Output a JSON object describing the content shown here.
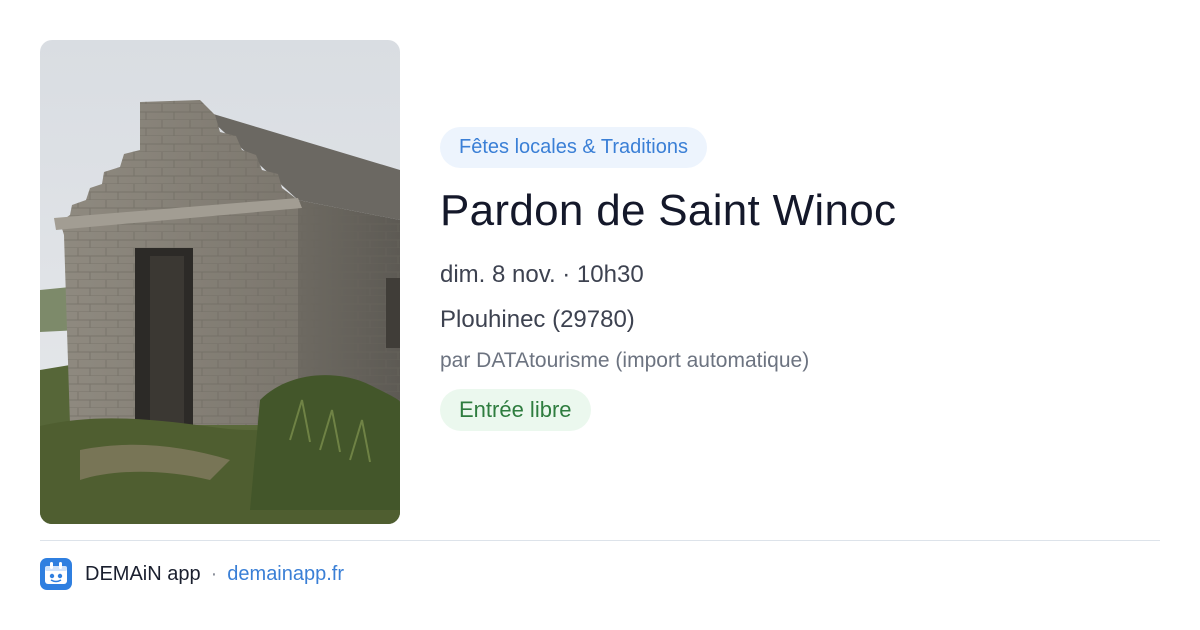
{
  "event": {
    "category": "Fêtes locales & Traditions",
    "title": "Pardon de Saint Winoc",
    "datetime": "dim. 8 nov. · 10h30",
    "location": "Plouhinec (29780)",
    "organizer": "par DATAtourisme (import automatique)",
    "price": "Entrée libre",
    "image": "stone-chapel-photo"
  },
  "footer": {
    "app_name": "DEMAiN app",
    "separator": "·",
    "link": "demainapp.fr",
    "icon": "demain-app-icon"
  },
  "colors": {
    "category_bg": "#edf4fd",
    "category_text": "#3a7fd6",
    "price_bg": "#ebf8ee",
    "price_text": "#2e7d3f",
    "link": "#3a7fd6",
    "title": "#14182a"
  }
}
